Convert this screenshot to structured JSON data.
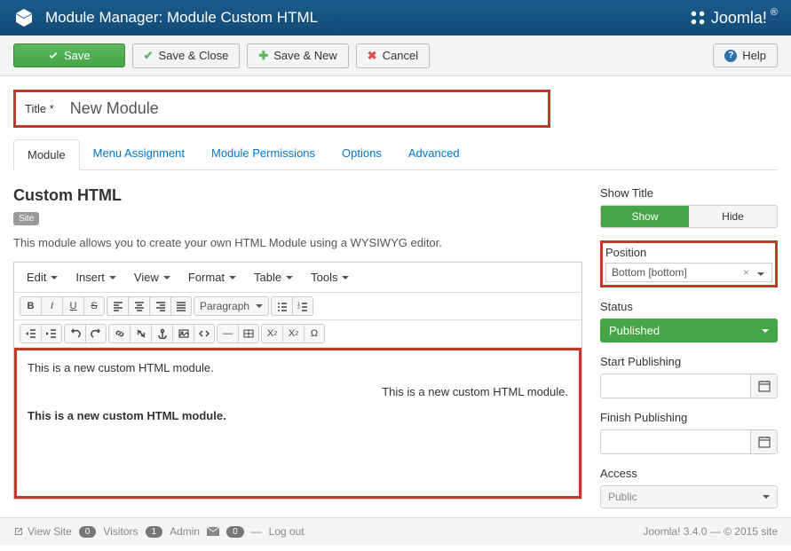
{
  "header": {
    "title": "Module Manager: Module Custom HTML",
    "brand": "Joomla!"
  },
  "toolbar": {
    "save": "Save",
    "save_close": "Save & Close",
    "save_new": "Save & New",
    "cancel": "Cancel",
    "help": "Help"
  },
  "title_field": {
    "label": "Title *",
    "value": "New Module"
  },
  "tabs": {
    "module": "Module",
    "menu_assignment": "Menu Assignment",
    "module_permissions": "Module Permissions",
    "options": "Options",
    "advanced": "Advanced"
  },
  "module": {
    "heading": "Custom HTML",
    "site_badge": "Site",
    "description": "This module allows you to create your own HTML Module using a WYSIWYG editor."
  },
  "editor_menus": {
    "edit": "Edit",
    "insert": "Insert",
    "view": "View",
    "format": "Format",
    "table": "Table",
    "tools": "Tools"
  },
  "editor": {
    "paragraph_select": "Paragraph",
    "content_line1": "This is a new custom HTML module.",
    "content_line2": "This is a new custom HTML module.",
    "content_line3": "This is a new custom HTML module."
  },
  "sidebar": {
    "show_title_label": "Show Title",
    "show": "Show",
    "hide": "Hide",
    "position_label": "Position",
    "position_value": "Bottom [bottom]",
    "status_label": "Status",
    "status_value": "Published",
    "start_label": "Start Publishing",
    "finish_label": "Finish Publishing",
    "access_label": "Access",
    "access_value": "Public"
  },
  "footer": {
    "view_site": "View Site",
    "visitors_count": "0",
    "visitors_label": "Visitors",
    "admin_count": "1",
    "admin_label": "Admin",
    "msg_count": "0",
    "logout": "Log out",
    "version": "Joomla! 3.4.0 — © 2015 site"
  }
}
